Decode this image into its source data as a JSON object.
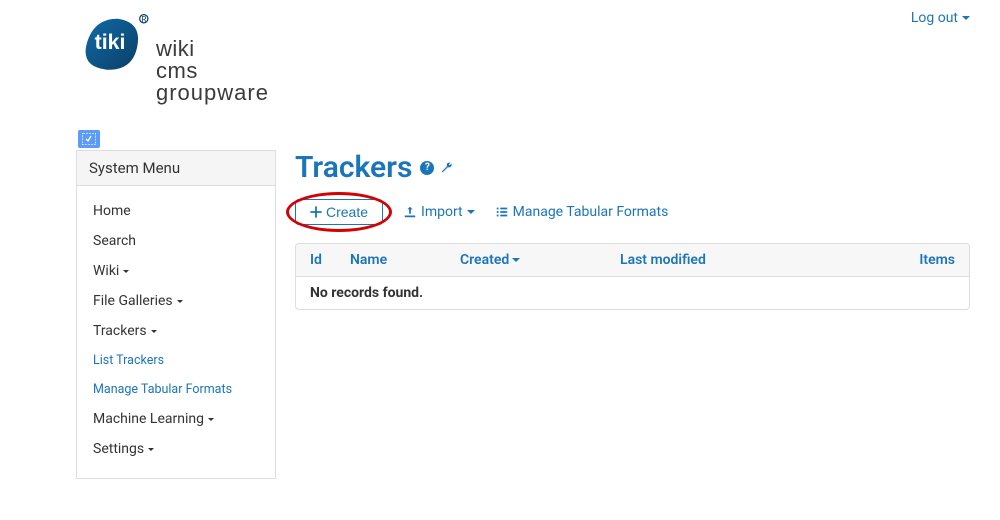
{
  "top": {
    "logout": "Log out"
  },
  "logo": {
    "line1": "wiki",
    "line2": "cms",
    "line3": "groupware"
  },
  "sidebar": {
    "title": "System Menu",
    "items": [
      {
        "label": "Home",
        "hasCaret": false,
        "sub": false
      },
      {
        "label": "Search",
        "hasCaret": false,
        "sub": false
      },
      {
        "label": "Wiki",
        "hasCaret": true,
        "sub": false
      },
      {
        "label": "File Galleries",
        "hasCaret": true,
        "sub": false
      },
      {
        "label": "Trackers",
        "hasCaret": true,
        "sub": false
      },
      {
        "label": "List Trackers",
        "hasCaret": false,
        "sub": true
      },
      {
        "label": "Manage Tabular Formats",
        "hasCaret": false,
        "sub": true
      },
      {
        "label": "Machine Learning",
        "hasCaret": true,
        "sub": false
      },
      {
        "label": "Settings",
        "hasCaret": true,
        "sub": false
      }
    ]
  },
  "main": {
    "title": "Trackers",
    "toolbar": {
      "create": "Create",
      "import": "Import",
      "manage_tabular": "Manage Tabular Formats"
    },
    "table": {
      "columns": {
        "id": "Id",
        "name": "Name",
        "created": "Created",
        "last_modified": "Last modified",
        "items": "Items"
      },
      "empty": "No records found."
    }
  }
}
